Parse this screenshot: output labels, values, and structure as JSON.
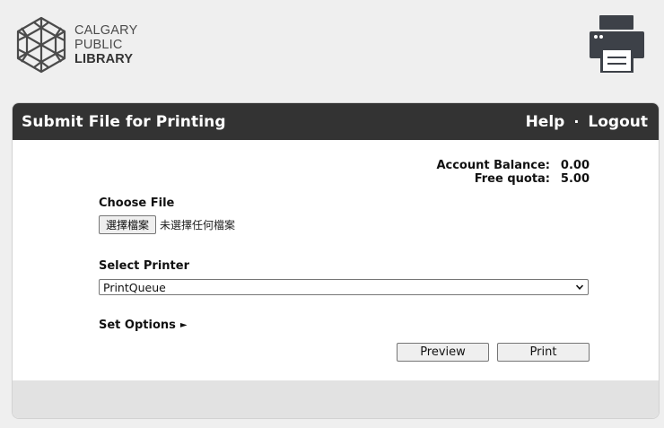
{
  "brand": {
    "logo_lines": [
      "CALGARY",
      "PUBLIC",
      "LIBRARY"
    ]
  },
  "icons": {
    "logo": "snowflake-logo-icon",
    "printer": "printer-icon",
    "select_arrow": "chevron-down-icon",
    "expand": "triangle-right-icon"
  },
  "header": {
    "title": "Submit File for Printing",
    "help_label": "Help",
    "separator": "·",
    "logout_label": "Logout"
  },
  "account": {
    "balance_label": "Account Balance:",
    "balance_value": "0.00",
    "quota_label": "Free quota:",
    "quota_value": "5.00"
  },
  "file": {
    "label": "Choose File",
    "button_label": "選擇檔案",
    "status": "未選擇任何檔案"
  },
  "printer": {
    "label": "Select Printer",
    "selected": "PrintQueue"
  },
  "options": {
    "label": "Set Options",
    "arrow": "►"
  },
  "actions": {
    "preview_label": "Preview",
    "print_label": "Print"
  },
  "colors": {
    "header_bg": "#333333",
    "page_bg": "#efefef",
    "footer_bg": "#e2e2e2",
    "logo_gray": "#4b4b4b",
    "printer_icon": "#3d4148"
  }
}
